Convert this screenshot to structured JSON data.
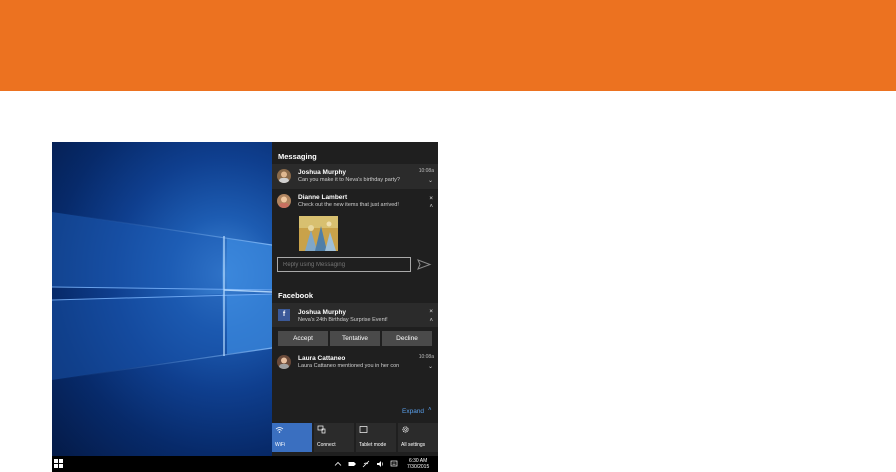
{
  "action_center": {
    "messaging": {
      "title": "Messaging",
      "notifications": [
        {
          "name": "Joshua Murphy",
          "message": "Can you make it to Neva's birthday party?",
          "time": "10:08a"
        },
        {
          "name": "Dianne Lambert",
          "message": "Check out the new items that just arrived!"
        }
      ],
      "reply_placeholder": "Reply using Messaging"
    },
    "facebook": {
      "title": "Facebook",
      "badge": "f",
      "notifications": [
        {
          "name": "Joshua Murphy",
          "message": "Neva's 24th Birthday Surprise Event!"
        },
        {
          "name": "Laura Cattaneo",
          "message": "Laura Cattaneo mentioned you in her con",
          "time": "10:08a"
        }
      ],
      "actions": [
        "Accept",
        "Tentative",
        "Decline"
      ]
    },
    "expand_label": "Expand",
    "quick_actions": [
      {
        "label": "WiFi",
        "icon": "wifi-icon",
        "active": true
      },
      {
        "label": "Connect",
        "icon": "connect-icon",
        "active": false
      },
      {
        "label": "Tablet mode",
        "icon": "tablet-mode-icon",
        "active": false
      },
      {
        "label": "All settings",
        "icon": "gear-icon",
        "active": false
      }
    ]
  },
  "taskbar": {
    "time": "6:30 AM",
    "date": "7/30/2015"
  },
  "colors": {
    "banner": "#ec7220",
    "panel": "#1f1f1f",
    "accent": "#3a6fc0",
    "link": "#5aa0ec"
  }
}
